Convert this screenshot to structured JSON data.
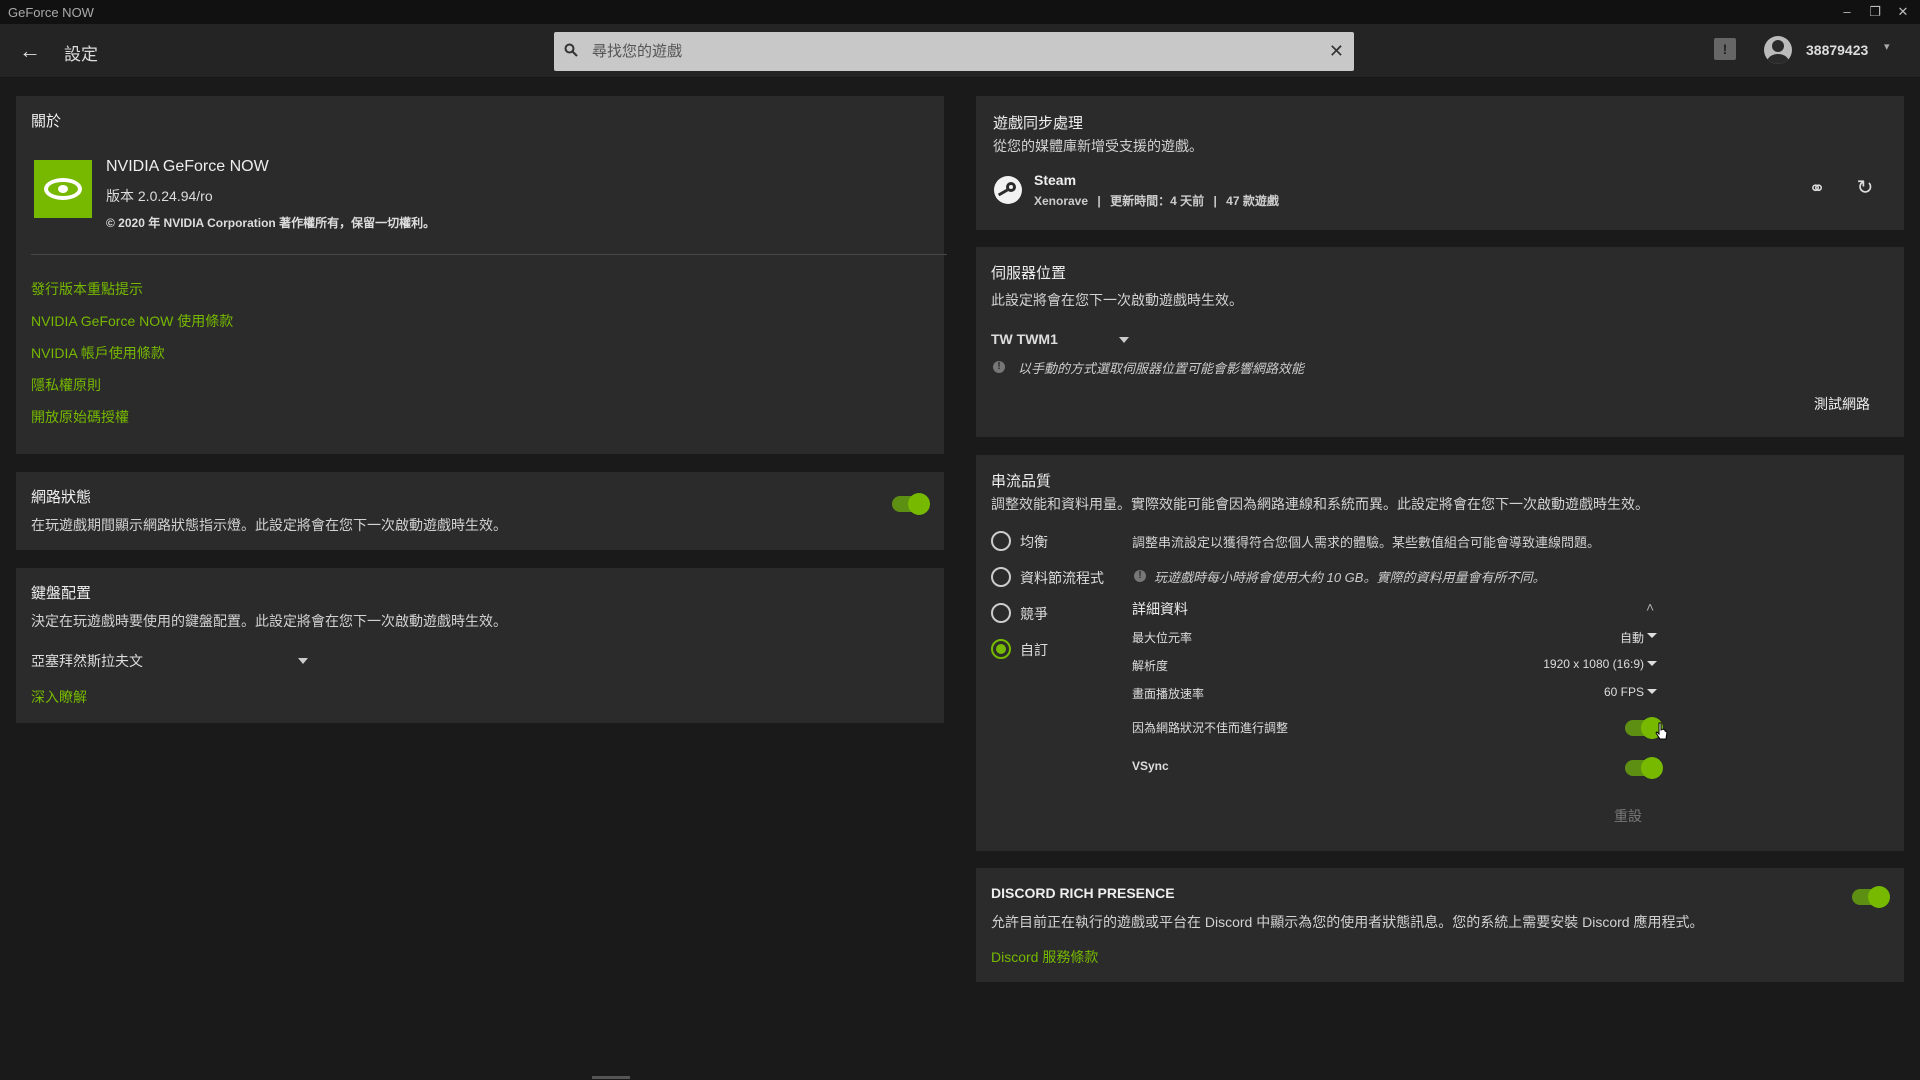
{
  "window": {
    "title": "GeForce NOW",
    "controls": [
      "–",
      "❐",
      "✕"
    ]
  },
  "header": {
    "back_icon": "←",
    "page_title": "設定",
    "search_placeholder": "尋找您的遊戲",
    "clear_icon": "✕",
    "notify_icon": "!",
    "username": "38879423",
    "user_chevron": "▾"
  },
  "about": {
    "title": "關於",
    "app_name": "NVIDIA GeForce NOW",
    "version": "版本 2.0.24.94/ro",
    "copyright": "© 2020 年 NVIDIA Corporation 著作權所有，保留一切權利。",
    "links": [
      "發行版本重點提示",
      "NVIDIA GeForce NOW 使用條款",
      "NVIDIA 帳戶使用條款",
      "隱私權原則",
      "開放原始碼授權"
    ]
  },
  "network_status": {
    "title": "網路狀態",
    "desc": "在玩遊戲期間顯示網路狀態指示燈。此設定將會在您下一次啟動遊戲時生效。",
    "enabled": true
  },
  "keyboard": {
    "title": "鍵盤配置",
    "desc": "決定在玩遊戲時要使用的鍵盤配置。此設定將會在您下一次啟動遊戲時生效。",
    "selected": "亞塞拜然斯拉夫文",
    "learn_more": "深入瞭解"
  },
  "game_sync": {
    "title": "遊戲同步處理",
    "desc": "從您的媒體庫新增受支援的遊戲。",
    "platform": "Steam",
    "account": "Xenorave",
    "updated": "更新時間：4 天前",
    "games": "47 款遊戲",
    "sep": "|",
    "unlink_icon": "⚭",
    "refresh_icon": "↻"
  },
  "server": {
    "title": "伺服器位置",
    "desc": "此設定將會在您下一次啟動遊戲時生效。",
    "selected": "TW TWM1",
    "note": "以手動的方式選取伺服器位置可能會影響網路效能",
    "info_icon": "!",
    "test_network": "測試網路"
  },
  "streaming": {
    "title": "串流品質",
    "desc": "調整效能和資料用量。實際效能可能會因為網路連線和系統而異。此設定將會在您下一次啟動遊戲時生效。",
    "presets": [
      "均衡",
      "資料節流程式",
      "競爭",
      "自訂"
    ],
    "selected_index": 3,
    "preset_desc": "調整串流設定以獲得符合您個人需求的體驗。某些數值組合可能會導致連線問題。",
    "usage_note": "玩遊戲時每小時將會使用大約 10 GB。實際的資料用量會有所不同。",
    "info_icon": "!",
    "details_title": "詳細資料",
    "collapse_icon": "˄",
    "details": [
      {
        "label": "最大位元率",
        "value": "自動"
      },
      {
        "label": "解析度",
        "value": "1920 x 1080 (16:9)"
      },
      {
        "label": "畫面播放速率",
        "value": "60 FPS"
      }
    ],
    "adjust_label": "因為網路狀況不佳而進行調整",
    "adjust_enabled": true,
    "vsync_label": "VSync",
    "vsync_enabled": true,
    "reset": "重設"
  },
  "discord": {
    "title": "DISCORD RICH PRESENCE",
    "desc": "允許目前正在執行的遊戲或平台在 Discord 中顯示為您的使用者狀態訊息。您的系統上需要安裝 Discord 應用程式。",
    "terms": "Discord 服務條款",
    "enabled": true
  },
  "colors": {
    "accent": "#76b900",
    "background": "#1a1a1a",
    "card": "#2b2b2b"
  }
}
